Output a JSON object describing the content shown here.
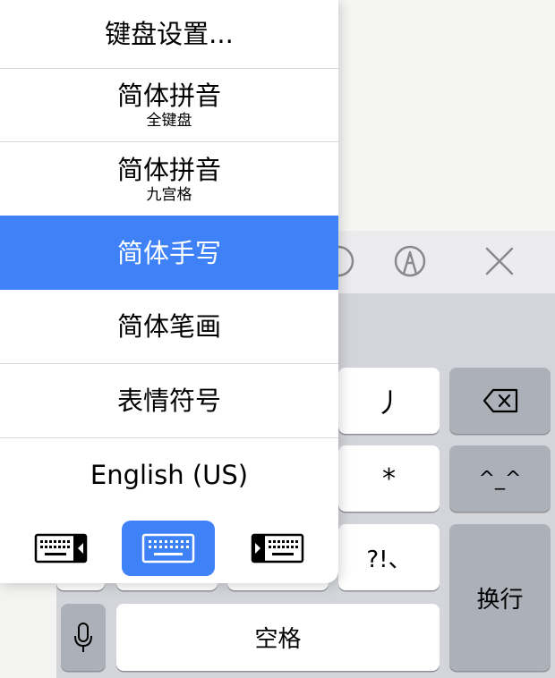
{
  "menu": {
    "items": [
      {
        "main": "键盘设置...",
        "sub": ""
      },
      {
        "main": "简体拼音",
        "sub": "全键盘"
      },
      {
        "main": "简体拼音",
        "sub": "九宫格"
      },
      {
        "main": "简体手写",
        "sub": ""
      },
      {
        "main": "简体笔画",
        "sub": ""
      },
      {
        "main": "表情符号",
        "sub": ""
      },
      {
        "main": "English (US)",
        "sub": ""
      }
    ],
    "selected_index": 3
  },
  "keys": {
    "stroke": "丿",
    "asterisk": "*",
    "emoticon": "^_^",
    "punct": "?!、",
    "return": "换行",
    "space": "空格"
  },
  "colors": {
    "accent": "#3f82f7",
    "keyboard_bg": "#d3d5da",
    "key_dark": "#acb0b8"
  }
}
